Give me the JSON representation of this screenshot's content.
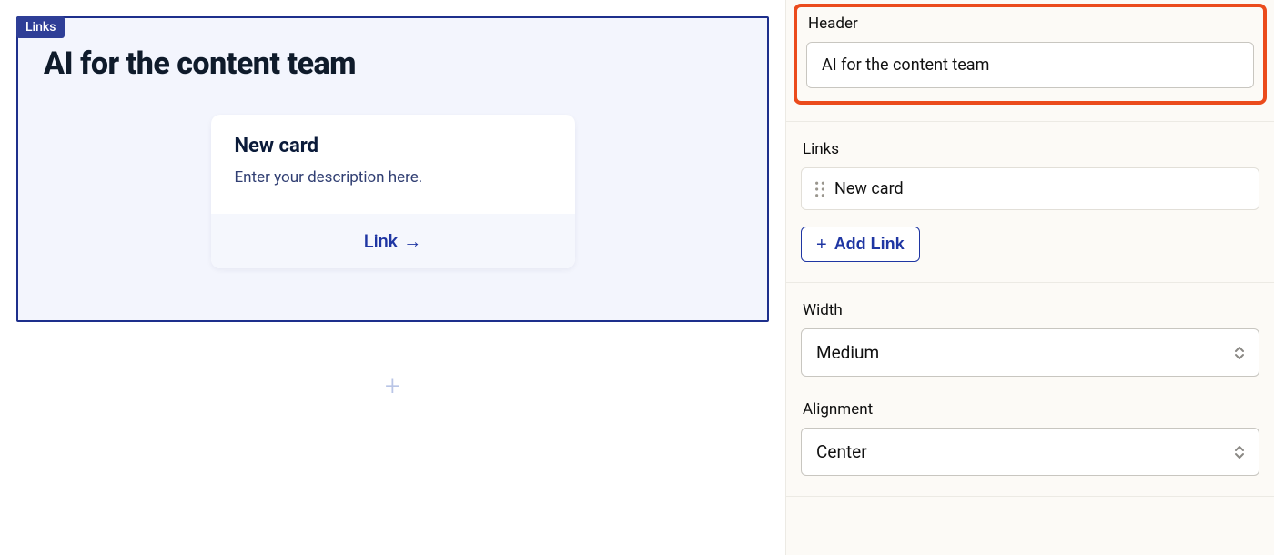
{
  "preview": {
    "tag_label": "Links",
    "header": "AI for the content team",
    "card": {
      "title": "New card",
      "description": "Enter your description here.",
      "link_label": "Link"
    }
  },
  "sidebar": {
    "header_section": {
      "label": "Header",
      "value": "AI for the content team"
    },
    "links_section": {
      "label": "Links",
      "items": [
        {
          "title": "New card"
        }
      ],
      "add_button": "Add Link"
    },
    "width_section": {
      "label": "Width",
      "value": "Medium"
    },
    "alignment_section": {
      "label": "Alignment",
      "value": "Center"
    }
  }
}
